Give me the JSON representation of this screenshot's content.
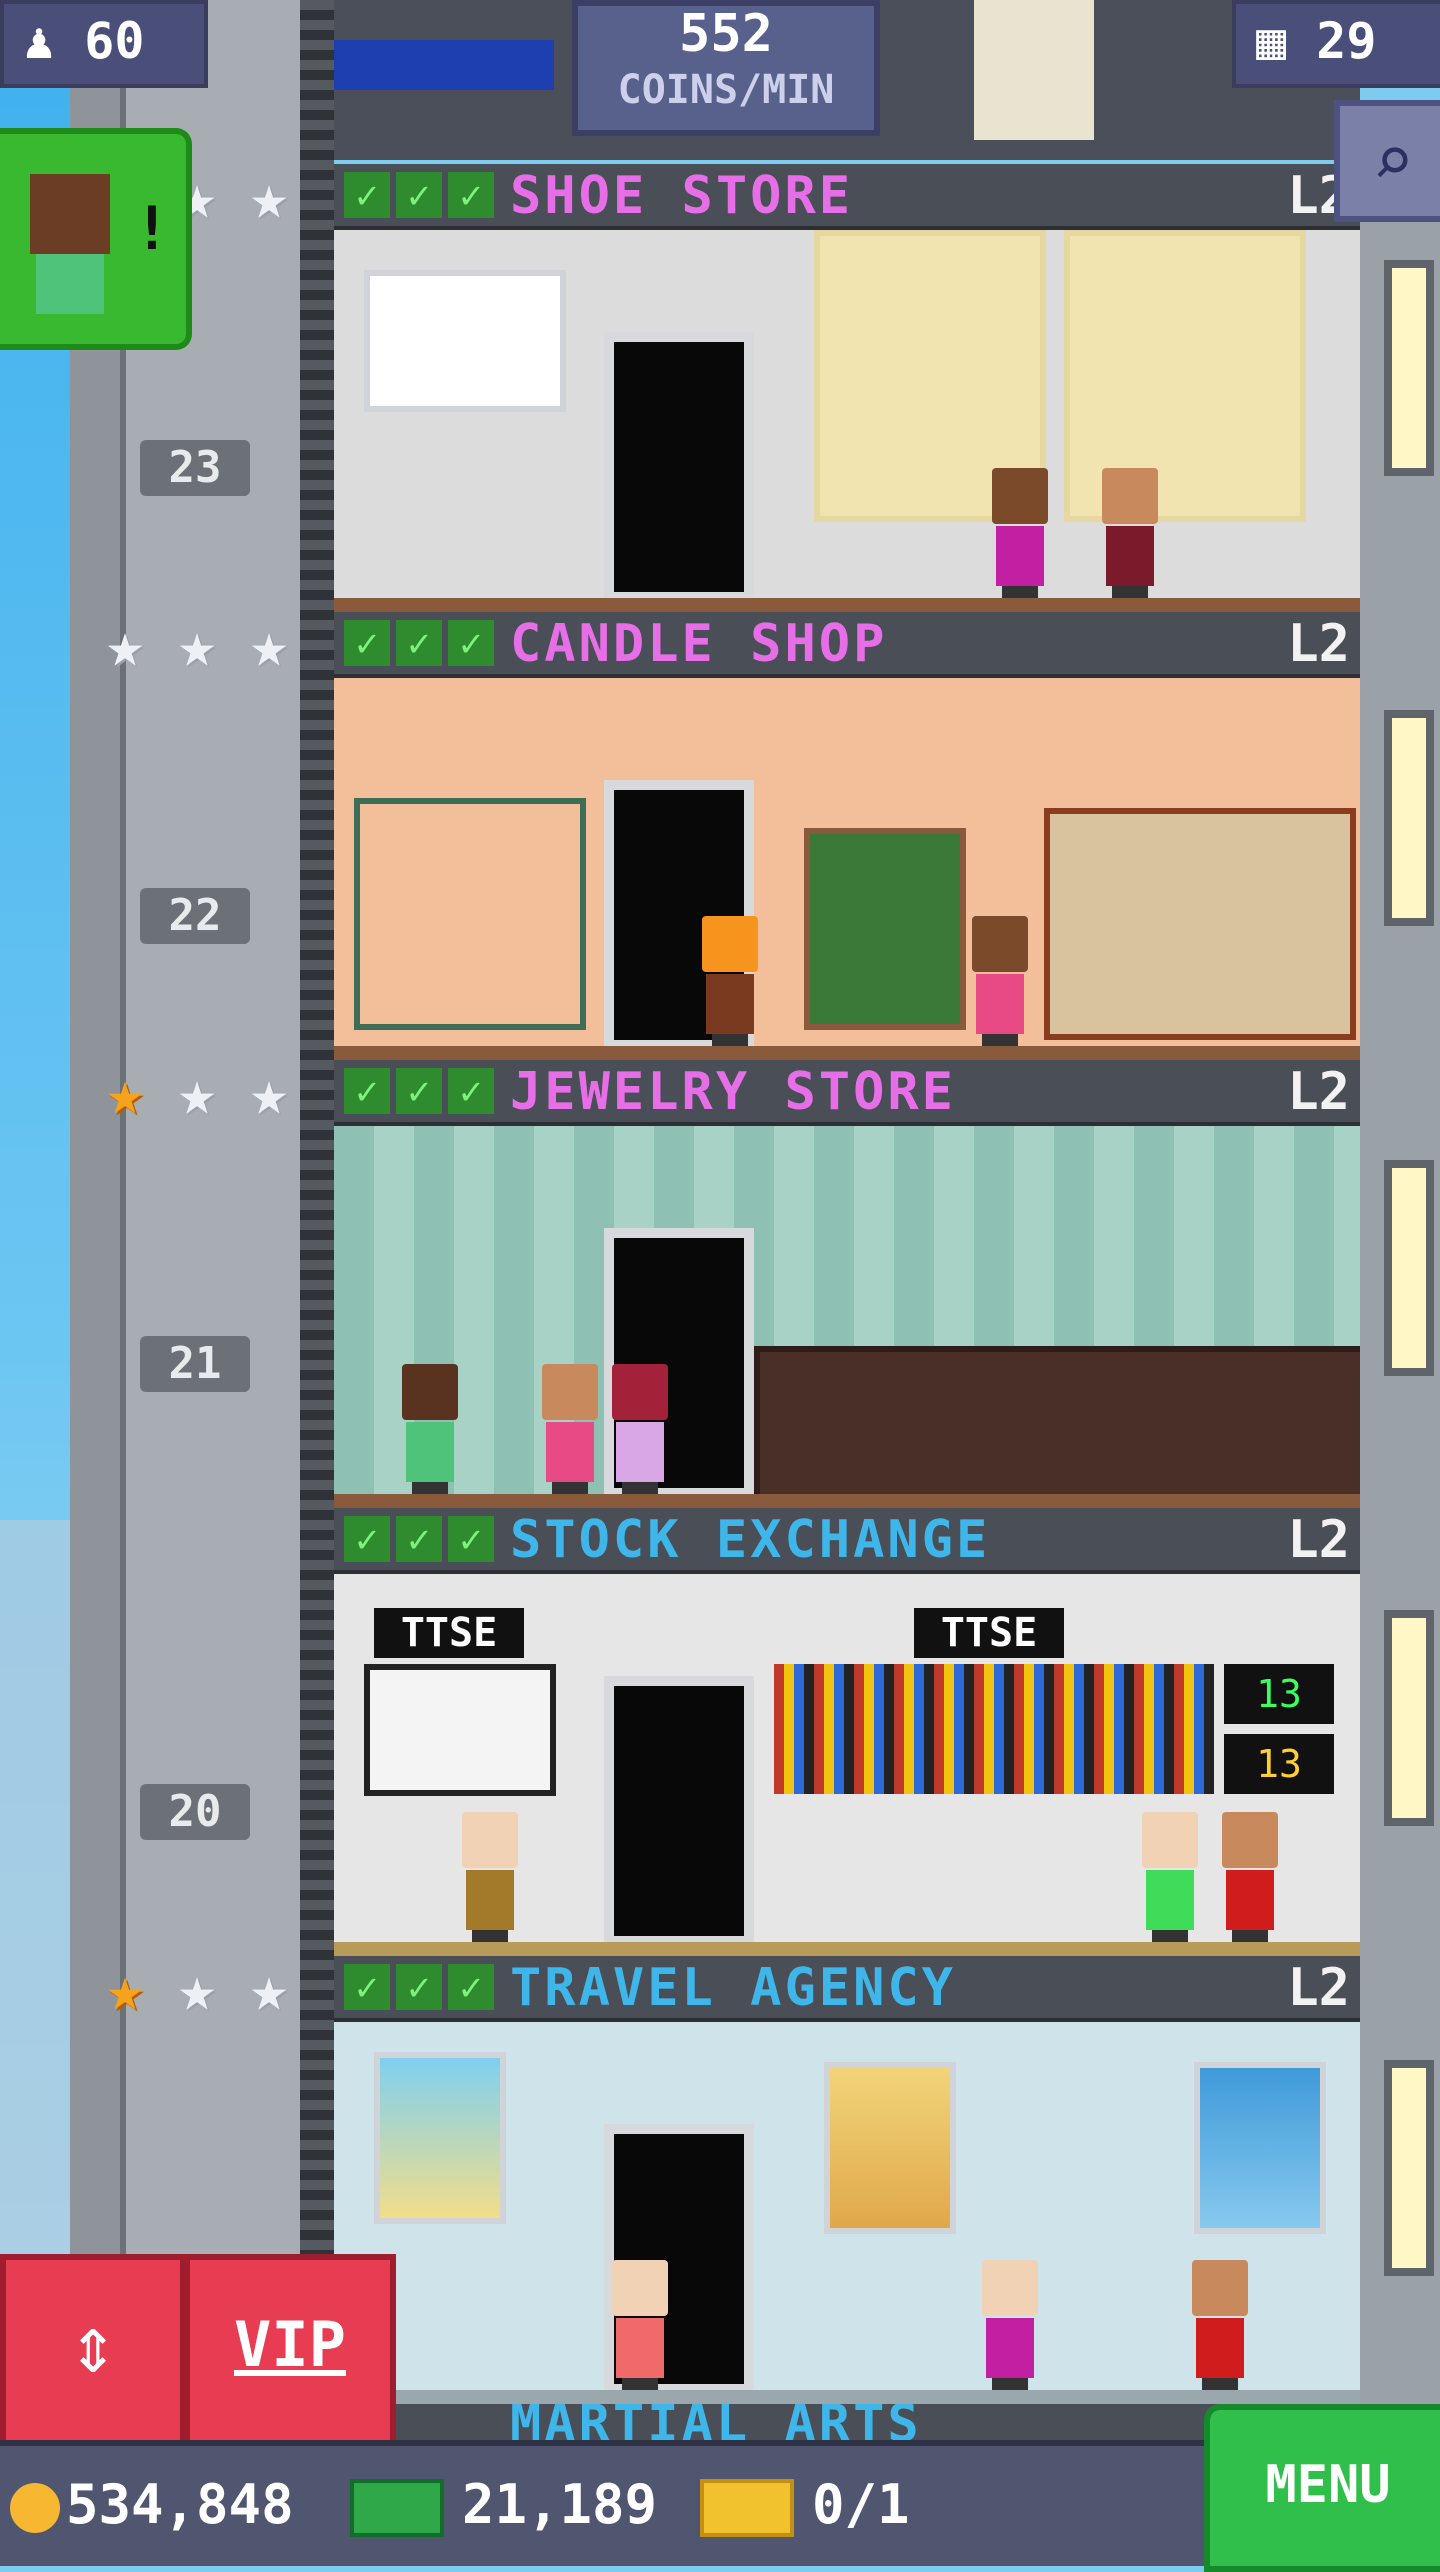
{
  "hud": {
    "population": "60",
    "coins_per_min_value": "552",
    "coins_per_min_label": "COINS/MIN",
    "floor_count": "29"
  },
  "floors": [
    {
      "name": "SHOE STORE",
      "level": "L2",
      "name_color": "#e66ee6",
      "number": "23",
      "stars": [
        "silver",
        "silver",
        "silver"
      ]
    },
    {
      "name": "CANDLE SHOP",
      "level": "L2",
      "name_color": "#e66ee6",
      "number": "22",
      "stars": [
        "silver",
        "silver",
        "silver"
      ]
    },
    {
      "name": "JEWELRY STORE",
      "level": "L2",
      "name_color": "#e66ee6",
      "number": "21",
      "stars": [
        "gold",
        "silver",
        "silver"
      ]
    },
    {
      "name": "STOCK EXCHANGE",
      "level": "L2",
      "name_color": "#3fb6ea",
      "number": "20",
      "stars": []
    },
    {
      "name": "TRAVEL AGENCY",
      "level": "L2",
      "name_color": "#3fb6ea",
      "number": "",
      "stars": [
        "gold",
        "silver",
        "silver"
      ]
    }
  ],
  "partial_floor_name": "MARTIAL ARTS",
  "signs": {
    "stock_left": "TTSE",
    "stock_right": "TTSE",
    "ticker1": "13",
    "ticker2": "13"
  },
  "bottom": {
    "coins": "534,848",
    "bux": "21,189",
    "tickets": "0/1",
    "menu_label": "MENU",
    "vip_label": "VIP"
  },
  "colors": {
    "coin": "#f7b731",
    "bux": "#2fa84a",
    "ticket": "#f2c12e"
  }
}
